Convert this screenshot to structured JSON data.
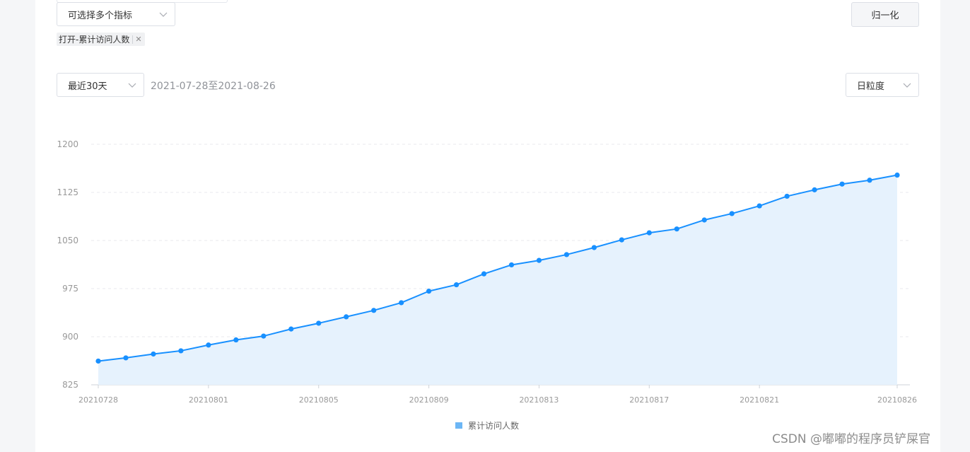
{
  "controls": {
    "metric_select_placeholder": "可选择多个指标",
    "selected_tags": [
      "打开-累计访问人数"
    ],
    "normalize_button": "归一化",
    "range_select_value": "最近30天",
    "date_range_text": "2021-07-28至2021-08-26",
    "granularity_select_value": "日粒度"
  },
  "icons": {
    "select_arrow": "chevron-down-icon",
    "tag_close": "close-icon"
  },
  "colors": {
    "series_line": "#1890ff",
    "series_area": "#e6f2fd",
    "legend_swatch": "#6cb6f5"
  },
  "watermark": "CSDN @嘟嘟的程序员铲屎官",
  "chart_data": {
    "type": "area",
    "x_tick_labels": [
      "20210728",
      "20210801",
      "20210805",
      "20210809",
      "20210813",
      "20210817",
      "20210821",
      "20210826"
    ],
    "x": [
      "20210728",
      "20210729",
      "20210730",
      "20210731",
      "20210801",
      "20210802",
      "20210803",
      "20210804",
      "20210805",
      "20210806",
      "20210807",
      "20210808",
      "20210809",
      "20210810",
      "20210811",
      "20210812",
      "20210813",
      "20210814",
      "20210815",
      "20210816",
      "20210817",
      "20210818",
      "20210819",
      "20210820",
      "20210821",
      "20210822",
      "20210823",
      "20210824",
      "20210825",
      "20210826"
    ],
    "series": [
      {
        "name": "累计访问人数",
        "values": [
          862,
          867,
          873,
          878,
          887,
          895,
          901,
          912,
          921,
          931,
          941,
          953,
          971,
          981,
          998,
          1012,
          1019,
          1028,
          1039,
          1051,
          1062,
          1068,
          1082,
          1092,
          1104,
          1119,
          1129,
          1138,
          1144,
          1152
        ]
      }
    ],
    "ylim": [
      825,
      1200
    ],
    "y_ticks": [
      825,
      900,
      975,
      1050,
      1125,
      1200
    ],
    "grid": true,
    "legend": "bottom-center"
  }
}
